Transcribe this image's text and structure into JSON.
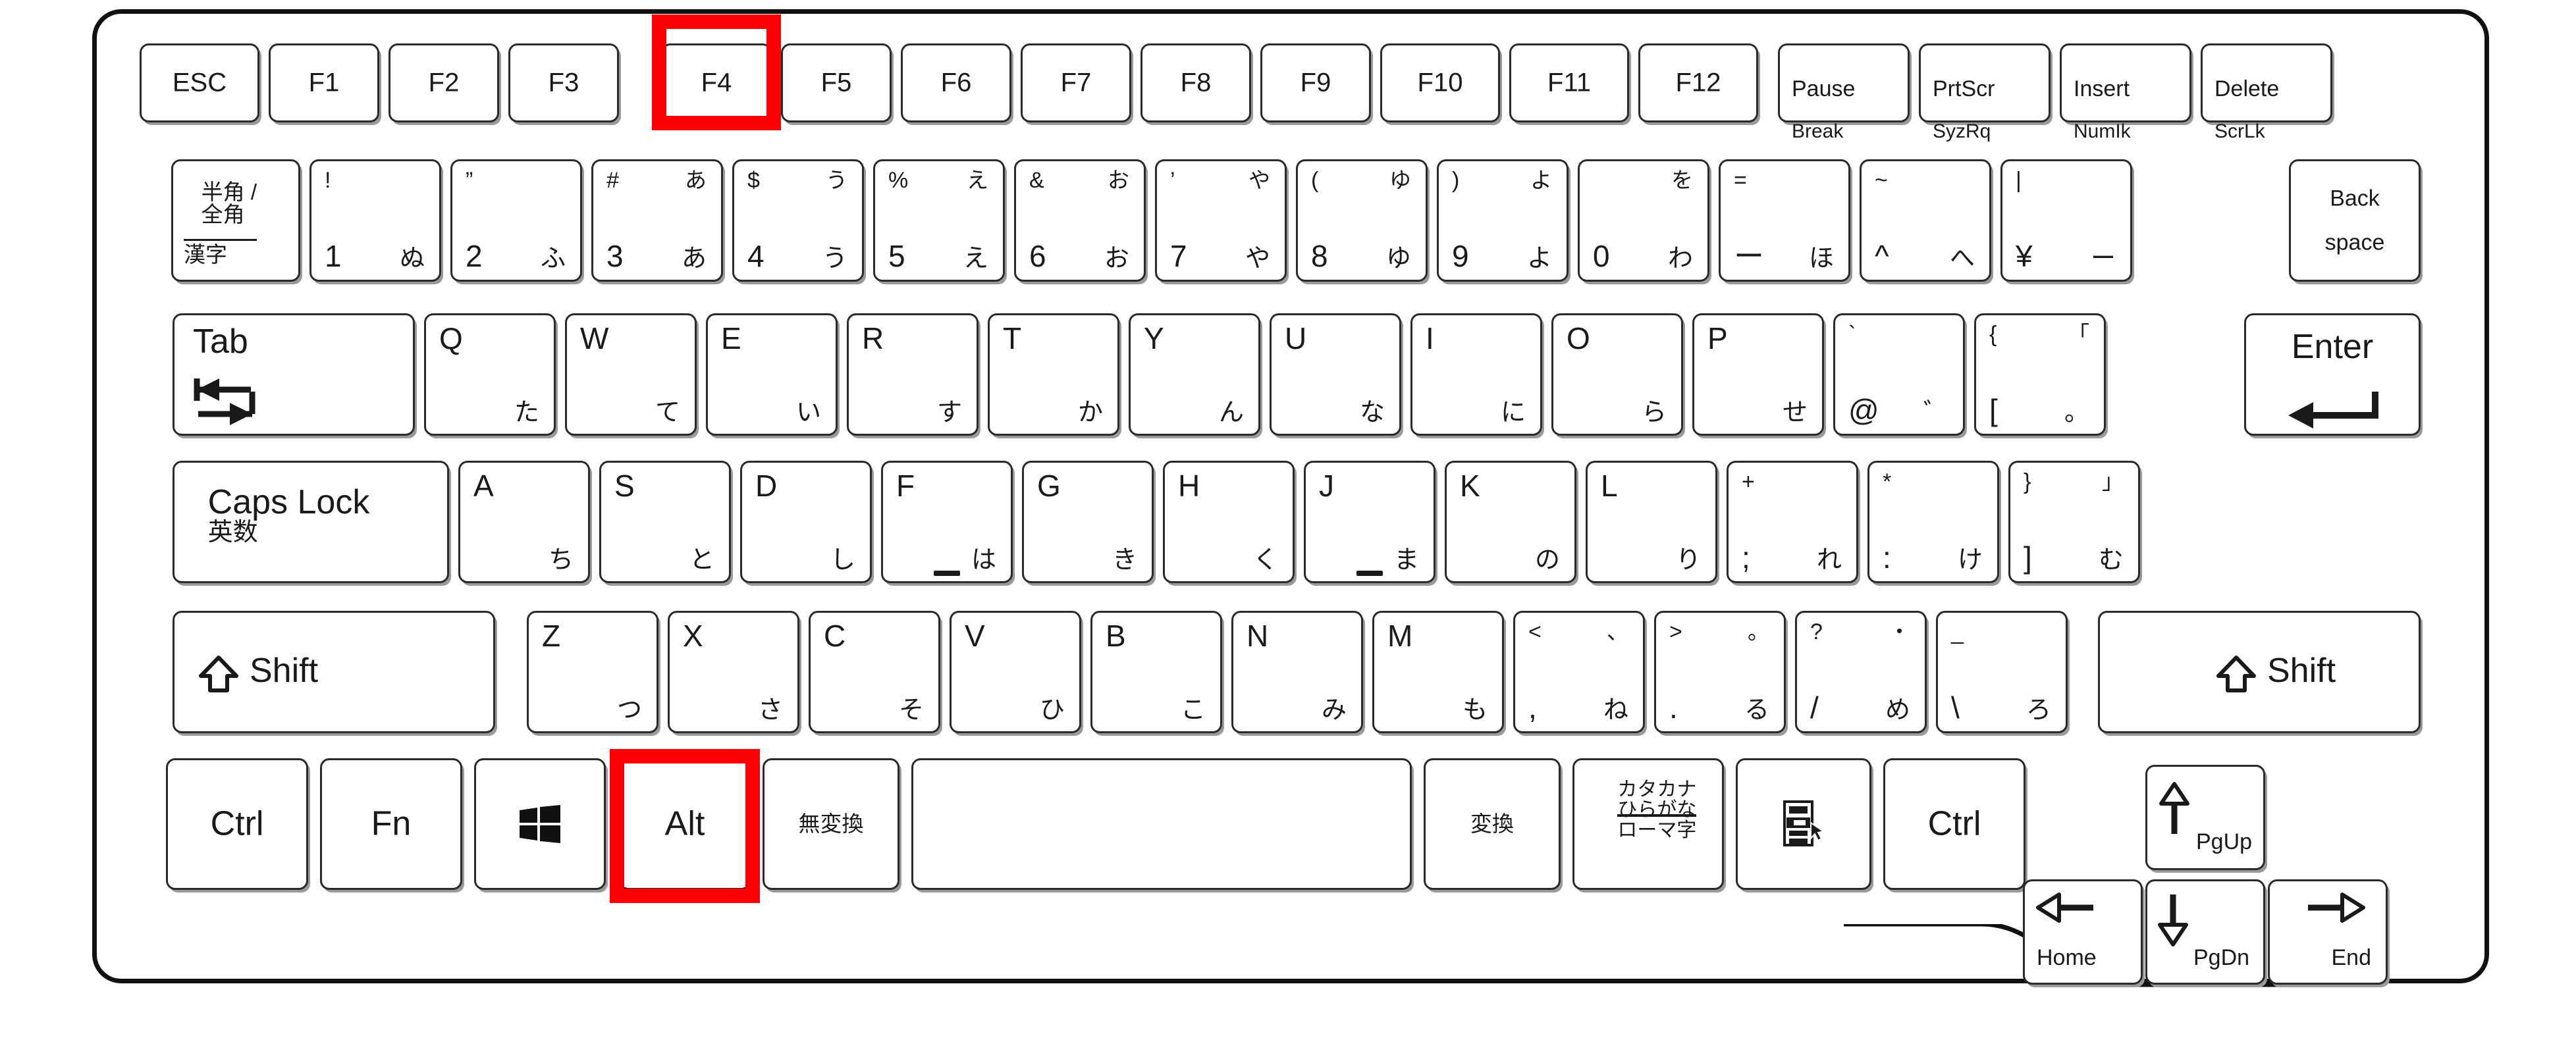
{
  "diagram": {
    "title": "Japanese JIS laptop keyboard layout",
    "highlight_color": "#fb0007",
    "highlighted_keys": [
      "F4",
      "Alt"
    ]
  },
  "rows": {
    "function_row": [
      {
        "id": "esc",
        "label": "ESC"
      },
      {
        "id": "f1",
        "label": "F1"
      },
      {
        "id": "f2",
        "label": "F2"
      },
      {
        "id": "f3",
        "label": "F3"
      },
      {
        "id": "f4",
        "label": "F4"
      },
      {
        "id": "f5",
        "label": "F5"
      },
      {
        "id": "f6",
        "label": "F6"
      },
      {
        "id": "f7",
        "label": "F7"
      },
      {
        "id": "f8",
        "label": "F8"
      },
      {
        "id": "f9",
        "label": "F9"
      },
      {
        "id": "f10",
        "label": "F10"
      },
      {
        "id": "f11",
        "label": "F11"
      },
      {
        "id": "f12",
        "label": "F12"
      },
      {
        "id": "pause",
        "label": "Pause",
        "sub": "Break"
      },
      {
        "id": "prtscr",
        "label": "PrtScr",
        "sub": "SyzRq"
      },
      {
        "id": "insert",
        "label": "Insert",
        "sub": "NumIk"
      },
      {
        "id": "delete",
        "label": "Delete",
        "sub": "ScrLk"
      }
    ],
    "number_row": [
      {
        "id": "hankaku",
        "line1": "半角 /",
        "line2": "全角",
        "line3": "漢字"
      },
      {
        "id": "d1",
        "tl": "!",
        "tr": "",
        "bl": "1",
        "br": "ぬ"
      },
      {
        "id": "d2",
        "tl": "”",
        "tr": "",
        "bl": "2",
        "br": "ふ"
      },
      {
        "id": "d3",
        "tl": "#",
        "tr": "あ",
        "bl": "3",
        "br": "あ"
      },
      {
        "id": "d4",
        "tl": "$",
        "tr": "う",
        "bl": "4",
        "br": "う"
      },
      {
        "id": "d5",
        "tl": "%",
        "tr": "え",
        "bl": "5",
        "br": "え"
      },
      {
        "id": "d6",
        "tl": "&",
        "tr": "お",
        "bl": "6",
        "br": "お"
      },
      {
        "id": "d7",
        "tl": "’",
        "tr": "や",
        "bl": "7",
        "br": "や"
      },
      {
        "id": "d8",
        "tl": "(",
        "tr": "ゆ",
        "bl": "8",
        "br": "ゆ"
      },
      {
        "id": "d9",
        "tl": ")",
        "tr": "よ",
        "bl": "9",
        "br": "よ"
      },
      {
        "id": "d0",
        "tl": "",
        "tr": "を",
        "bl": "0",
        "br": "わ"
      },
      {
        "id": "minus",
        "tl": "=",
        "tr": "",
        "bl": "ー",
        "br": "ほ"
      },
      {
        "id": "caret",
        "tl": "~",
        "tr": "",
        "bl": "^",
        "br": "へ"
      },
      {
        "id": "yen",
        "tl": "|",
        "tr": "",
        "bl": "¥",
        "br": "ー"
      },
      {
        "id": "backspace",
        "line1": "Back",
        "line2": "space"
      }
    ],
    "qwerty_row": [
      {
        "id": "tab",
        "label": "Tab",
        "icon": "tab-arrows-icon"
      },
      {
        "id": "q",
        "tl": "Q",
        "br": "た"
      },
      {
        "id": "w",
        "tl": "W",
        "br": "て"
      },
      {
        "id": "e",
        "tl": "E",
        "br": "い"
      },
      {
        "id": "r",
        "tl": "R",
        "br": "す"
      },
      {
        "id": "t",
        "tl": "T",
        "br": "か"
      },
      {
        "id": "y",
        "tl": "Y",
        "br": "ん"
      },
      {
        "id": "u",
        "tl": "U",
        "br": "な"
      },
      {
        "id": "i",
        "tl": "I",
        "br": "に"
      },
      {
        "id": "o",
        "tl": "O",
        "br": "ら"
      },
      {
        "id": "p",
        "tl": "P",
        "br": "せ"
      },
      {
        "id": "at",
        "tl": "`",
        "bl": "@",
        "br": "゛"
      },
      {
        "id": "bracketleft",
        "tl": "{",
        "tr": "「",
        "bl": "[",
        "br": "。"
      },
      {
        "id": "enter",
        "label": "Enter",
        "icon": "enter-arrow-icon"
      }
    ],
    "home_row": [
      {
        "id": "capslock",
        "line1": "Caps Lock",
        "line2": "英数"
      },
      {
        "id": "a",
        "tl": "A",
        "br": "ち"
      },
      {
        "id": "s",
        "tl": "S",
        "br": "と"
      },
      {
        "id": "d",
        "tl": "D",
        "br": "し"
      },
      {
        "id": "f",
        "tl": "F",
        "br": "は",
        "homing": true
      },
      {
        "id": "g",
        "tl": "G",
        "br": "き"
      },
      {
        "id": "h",
        "tl": "H",
        "br": "く"
      },
      {
        "id": "j",
        "tl": "J",
        "br": "ま",
        "homing": true
      },
      {
        "id": "k",
        "tl": "K",
        "br": "の"
      },
      {
        "id": "l",
        "tl": "L",
        "br": "り"
      },
      {
        "id": "semicolon",
        "tl": "+",
        "bl": ";",
        "br": "れ"
      },
      {
        "id": "colon",
        "tl": "*",
        "bl": ":",
        "br": "け"
      },
      {
        "id": "bracketright",
        "tl": "}",
        "tr": "」",
        "bl": "]",
        "br": "む"
      }
    ],
    "shift_row": [
      {
        "id": "lshift",
        "label": "Shift",
        "icon": "shift-arrow-icon"
      },
      {
        "id": "z",
        "tl": "Z",
        "br": "つ"
      },
      {
        "id": "x",
        "tl": "X",
        "br": "さ"
      },
      {
        "id": "c",
        "tl": "C",
        "br": "そ"
      },
      {
        "id": "v",
        "tl": "V",
        "br": "ひ"
      },
      {
        "id": "b",
        "tl": "B",
        "br": "こ"
      },
      {
        "id": "n",
        "tl": "N",
        "br": "み"
      },
      {
        "id": "m",
        "tl": "M",
        "br": "も"
      },
      {
        "id": "comma",
        "tl": "<",
        "tr": "、",
        "bl": ",",
        "br": "ね"
      },
      {
        "id": "period",
        "tl": ">",
        "tr": "。",
        "bl": ".",
        "br": "る"
      },
      {
        "id": "slash",
        "tl": "?",
        "tr": "・",
        "bl": "/",
        "br": "め"
      },
      {
        "id": "backslash",
        "tl": "_",
        "bl": "\\",
        "br": "ろ"
      },
      {
        "id": "rshift",
        "label": "Shift",
        "icon": "shift-arrow-icon"
      }
    ],
    "bottom_row": [
      {
        "id": "lctrl",
        "label": "Ctrl"
      },
      {
        "id": "fn",
        "label": "Fn"
      },
      {
        "id": "win",
        "label": "",
        "icon": "windows-logo-icon"
      },
      {
        "id": "lalt",
        "label": "Alt"
      },
      {
        "id": "muhenkan",
        "label": "無変換"
      },
      {
        "id": "space",
        "label": ""
      },
      {
        "id": "henkan",
        "label": "変換"
      },
      {
        "id": "katakana",
        "line1": "カタカナ",
        "line2": "ひらがな",
        "line3": "ローマ字"
      },
      {
        "id": "menu",
        "label": "",
        "icon": "context-menu-icon"
      },
      {
        "id": "rctrl",
        "label": "Ctrl"
      }
    ],
    "arrow_cluster": [
      {
        "id": "up",
        "label": "PgUp",
        "icon": "arrow-up-icon"
      },
      {
        "id": "left",
        "label": "Home",
        "icon": "arrow-left-icon"
      },
      {
        "id": "down",
        "label": "PgDn",
        "icon": "arrow-down-icon"
      },
      {
        "id": "right",
        "label": "End",
        "icon": "arrow-right-icon"
      }
    ]
  }
}
